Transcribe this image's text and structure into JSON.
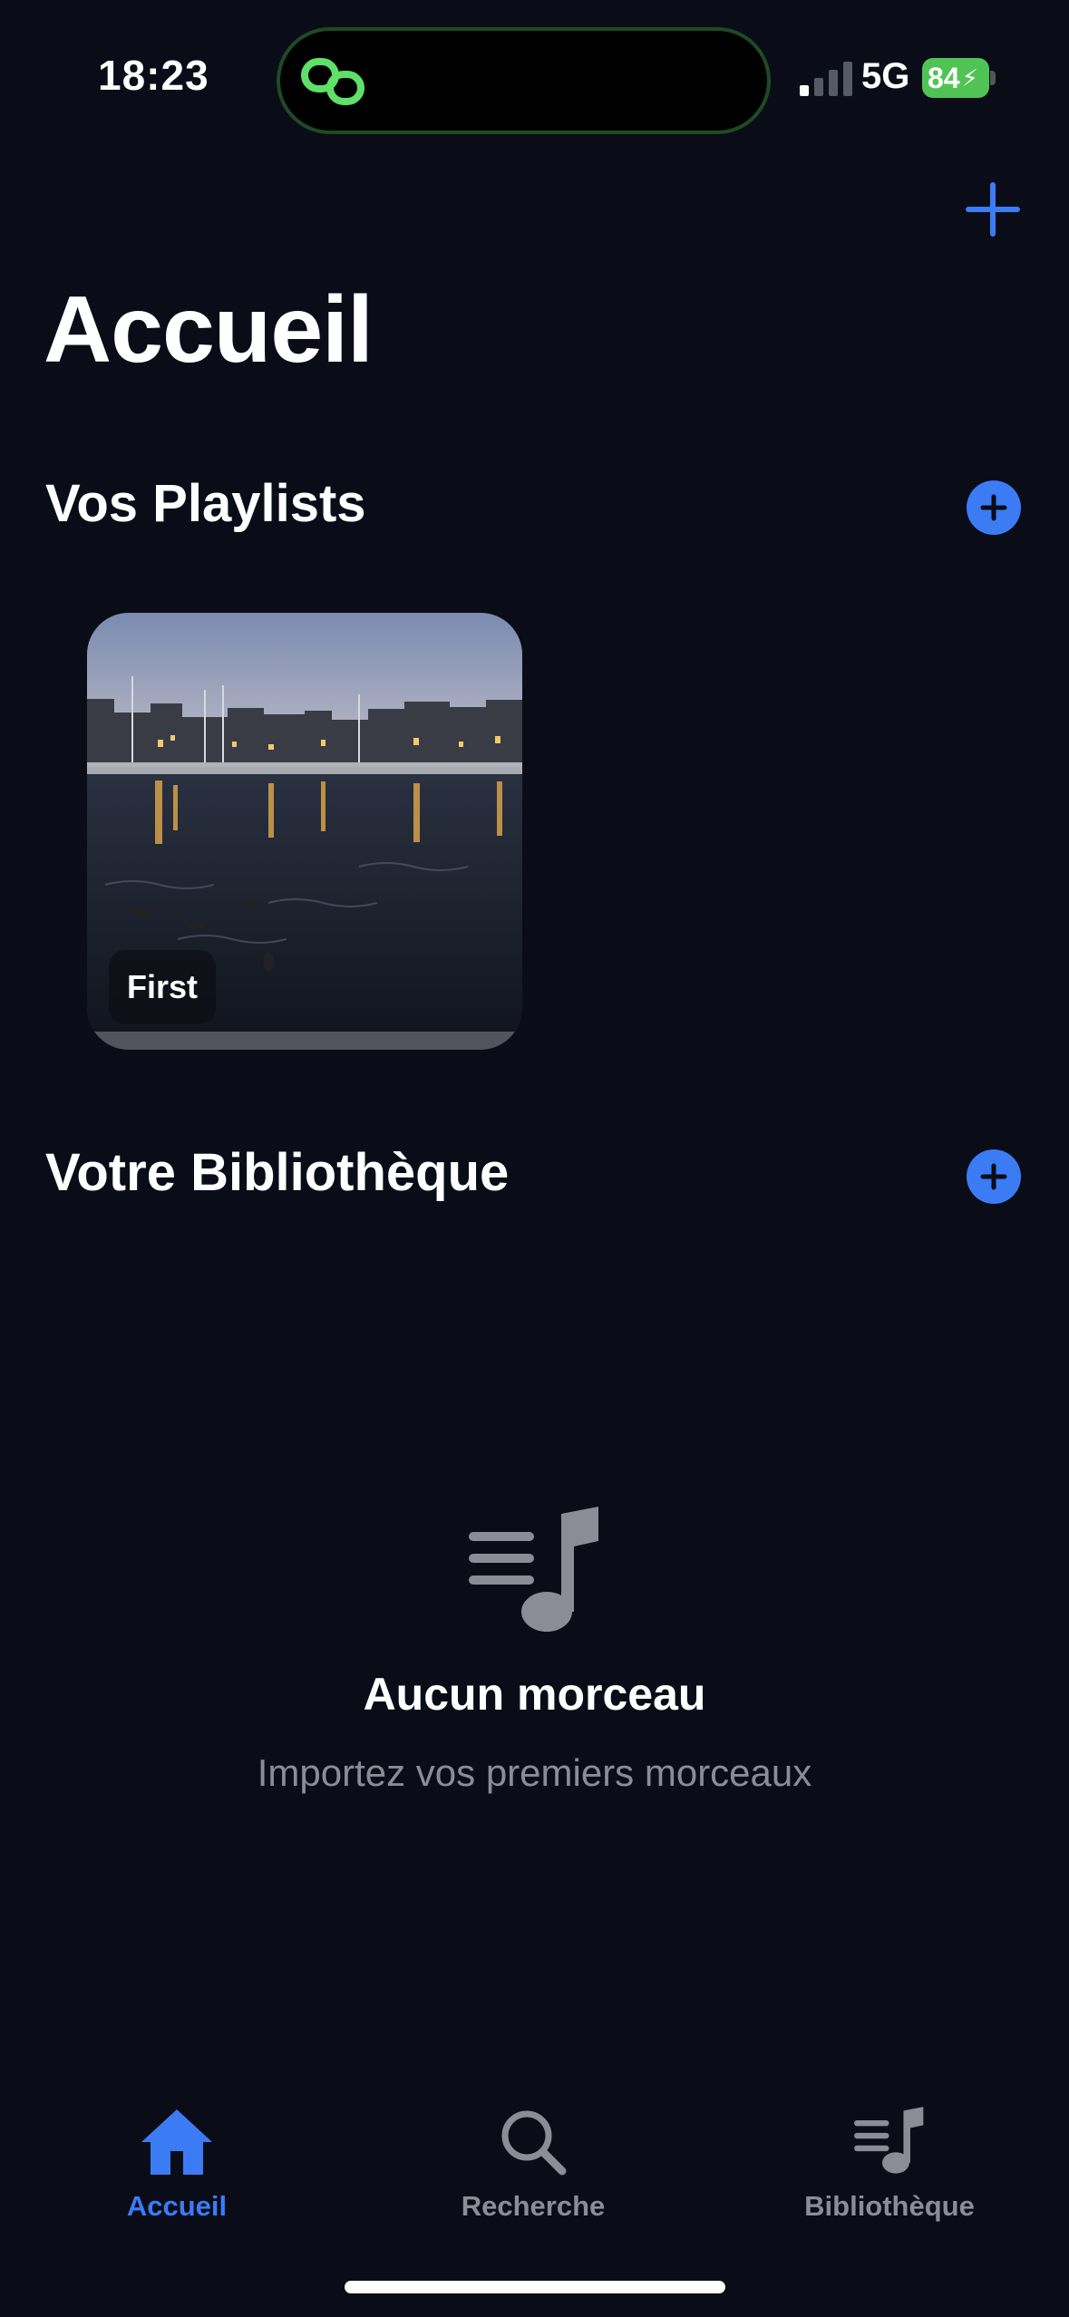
{
  "status_bar": {
    "time": "18:23",
    "network": "5G",
    "battery": "84"
  },
  "header": {
    "title": "Accueil"
  },
  "playlists": {
    "title": "Vos Playlists",
    "items": [
      {
        "name": "First"
      }
    ]
  },
  "library": {
    "title": "Votre Bibliothèque",
    "empty_title": "Aucun morceau",
    "empty_subtitle": "Importez vos premiers morceaux"
  },
  "tab_bar": {
    "items": [
      {
        "label": "Accueil",
        "icon": "home-icon",
        "active": true
      },
      {
        "label": "Recherche",
        "icon": "search-icon",
        "active": false
      },
      {
        "label": "Bibliothèque",
        "icon": "music-library-icon",
        "active": false
      }
    ]
  },
  "colors": {
    "accent": "#3b7cf5",
    "background": "#0a0c18",
    "inactive": "#8a8d96",
    "island_icon": "#5ee06a"
  }
}
